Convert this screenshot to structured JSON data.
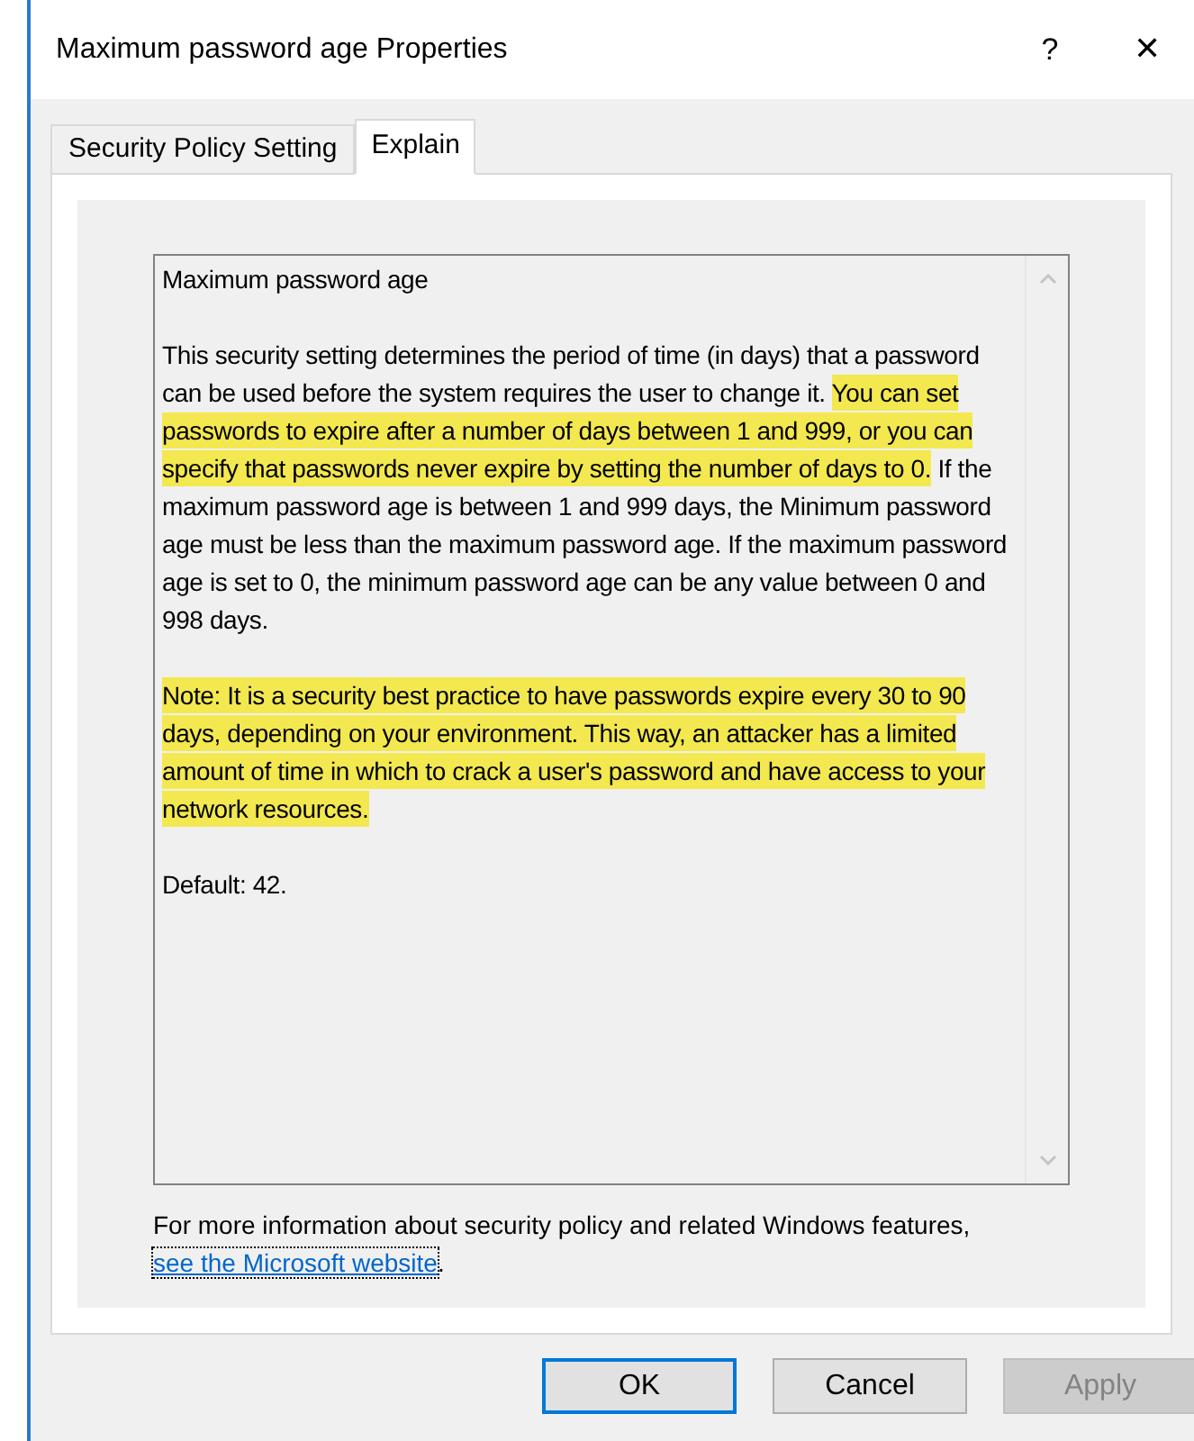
{
  "window": {
    "title": "Maximum password age Properties",
    "help_button": "?",
    "close_button": "✕"
  },
  "tabs": [
    {
      "label": "Security Policy Setting",
      "selected": false
    },
    {
      "label": "Explain",
      "selected": true
    }
  ],
  "explain": {
    "heading": "Maximum password age",
    "paragraphs": [
      [
        {
          "text": "This security setting determines the period of time (in days) that a password can be used before the system requires the user to change it. ",
          "highlighted": false
        },
        {
          "text": "You can set passwords to expire after a number of days between 1 and 999, or you can specify that passwords never expire by setting the number of days to 0.",
          "highlighted": true
        },
        {
          "text": " If the maximum password age is between 1 and 999 days, the Minimum password age must be less than the maximum password age. If the maximum password age is set to 0, the minimum password age can be any value between 0 and 998 days.",
          "highlighted": false
        }
      ],
      [
        {
          "text": "Note: It is a security best practice to have passwords expire every 30 to 90 days, depending on your environment. This way, an attacker has a limited amount of time in which to crack a user's password and have access to your network resources.",
          "highlighted": true
        }
      ],
      [
        {
          "text": "Default: 42.",
          "highlighted": false
        }
      ]
    ]
  },
  "more_info": {
    "text": "For more information about security policy and related Windows features, ",
    "link": "see the Microsoft website",
    "end": "."
  },
  "buttons": [
    {
      "label": "OK",
      "default": true,
      "disabled": false
    },
    {
      "label": "Cancel",
      "default": false,
      "disabled": false
    },
    {
      "label": "Apply",
      "default": false,
      "disabled": true
    }
  ]
}
